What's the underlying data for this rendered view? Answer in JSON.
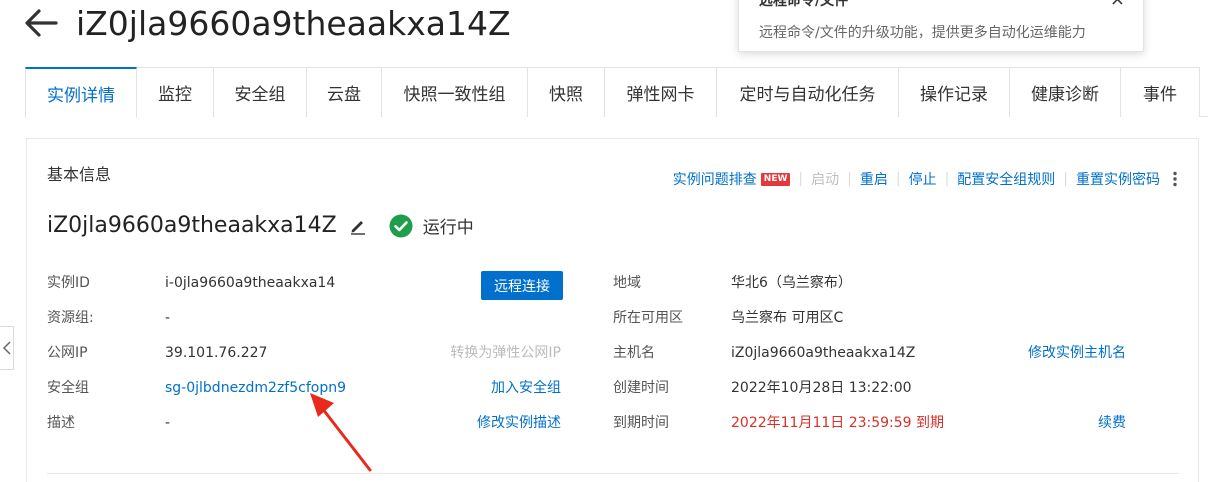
{
  "header": {
    "title": "iZ0jla9660a9theaakxa14Z"
  },
  "tooltip": {
    "title": "远程命令/文件",
    "description": "远程命令/文件的升级功能，提供更多自动化运维能力",
    "close": "×"
  },
  "tabs": [
    {
      "label": "实例详情",
      "active": true
    },
    {
      "label": "监控"
    },
    {
      "label": "安全组"
    },
    {
      "label": "云盘"
    },
    {
      "label": "快照一致性组"
    },
    {
      "label": "快照"
    },
    {
      "label": "弹性网卡"
    },
    {
      "label": "定时与自动化任务"
    },
    {
      "label": "操作记录"
    },
    {
      "label": "健康诊断"
    },
    {
      "label": "事件"
    }
  ],
  "card": {
    "section_title": "基本信息",
    "actions": {
      "troubleshoot": "实例问题排查",
      "new_badge": "NEW",
      "start": "启动",
      "restart": "重启",
      "stop": "停止",
      "config_sg_rules": "配置安全组规则",
      "reset_password": "重置实例密码"
    },
    "instance_name": "iZ0jla9660a9theaakxa14Z",
    "status": "运行中",
    "fields": {
      "instance_id_label": "实例ID",
      "instance_id": "i-0jla9660a9theaakxa14",
      "remote_connect": "远程连接",
      "resource_group_label": "资源组:",
      "resource_group": "-",
      "public_ip_label": "公网IP",
      "public_ip": "39.101.76.227",
      "convert_eip": "转换为弹性公网IP",
      "security_group_label": "安全组",
      "security_group": "sg-0jlbdnezdm2zf5cfopn9",
      "join_sg": "加入安全组",
      "description_label": "描述",
      "description": "-",
      "edit_description": "修改实例描述",
      "region_label": "地域",
      "region": "华北6（乌兰察布）",
      "zone_label": "所在可用区",
      "zone": "乌兰察布 可用区C",
      "hostname_label": "主机名",
      "hostname": "iZ0jla9660a9theaakxa14Z",
      "edit_hostname": "修改实例主机名",
      "created_label": "创建时间",
      "created": "2022年10月28日 13:22:00",
      "expire_label": "到期时间",
      "expire": "2022年11月11日 23:59:59 到期",
      "renew": "续费"
    }
  },
  "colors": {
    "accent": "#0070cc",
    "success": "#1e9e4a",
    "danger": "#d93026",
    "annotation": "#e8291c"
  },
  "icons": {
    "back": "arrow-left-icon",
    "edit": "pencil-icon",
    "status": "check-circle-icon",
    "more": "more-vertical-icon",
    "collapse": "chevron-left-icon"
  }
}
